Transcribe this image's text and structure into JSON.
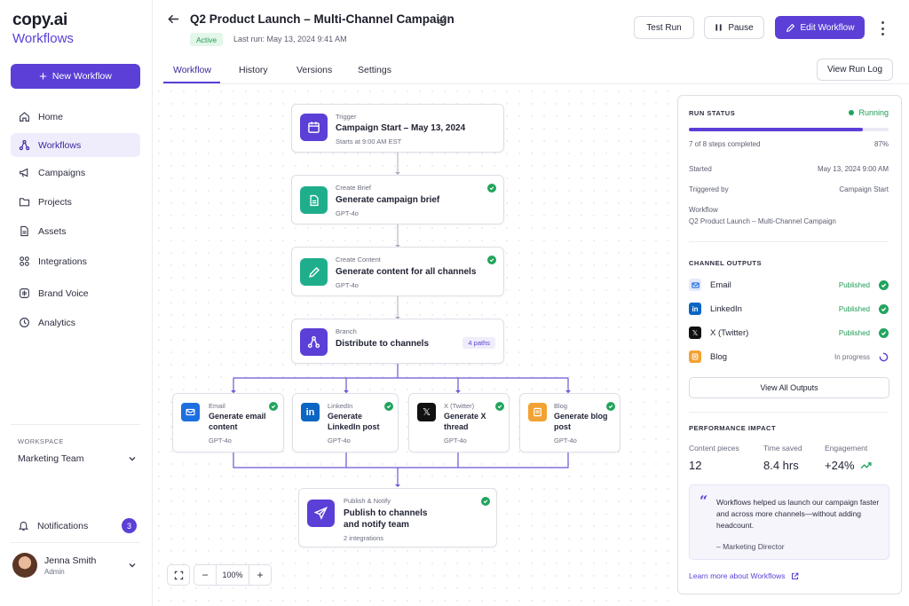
{
  "brand": {
    "logo": "copy.ai",
    "product": "Workflows"
  },
  "sidebar": {
    "new_workflow": "New Workflow",
    "items": [
      {
        "label": "Home",
        "icon": "home-icon"
      },
      {
        "label": "Workflows",
        "icon": "workflow-icon",
        "active": true
      },
      {
        "label": "Campaigns",
        "icon": "megaphone-icon"
      },
      {
        "label": "Projects",
        "icon": "folder-icon"
      },
      {
        "label": "Assets",
        "icon": "file-icon"
      },
      {
        "label": "Integrations",
        "icon": "grid-icon"
      },
      {
        "label": "Brand Voice",
        "icon": "voice-icon"
      },
      {
        "label": "Analytics",
        "icon": "analytics-icon"
      }
    ],
    "workspace_label": "WORKSPACE",
    "workspace": "Marketing Team",
    "notifications": "Notifications",
    "notifications_count": "3",
    "user": {
      "name": "Jenna Smith",
      "role": "Admin"
    }
  },
  "header": {
    "title": "Q2 Product Launch – Multi-Channel Campaign",
    "status": "Active",
    "last_run": "Last run: May 13, 2024 9:41 AM",
    "test_run": "Test Run",
    "pause": "Pause",
    "edit": "Edit Workflow"
  },
  "tabs": [
    "Workflow",
    "History",
    "Versions",
    "Settings"
  ],
  "view_run_log": "View Run Log",
  "canvas": {
    "trigger": {
      "label": "Trigger",
      "title": "Campaign Start – May 13, 2024",
      "sub": "Starts at 9:00 AM EST"
    },
    "brief": {
      "label": "Create Brief",
      "title": "Generate campaign brief",
      "sub": "GPT-4o"
    },
    "content": {
      "label": "Create Content",
      "title": "Generate content for all channels",
      "sub": "GPT-4o"
    },
    "branch": {
      "label": "Branch",
      "title": "Distribute to channels",
      "badge": "4 paths"
    },
    "channels": [
      {
        "label": "Email",
        "title": "Generate email content",
        "sub": "GPT-4o"
      },
      {
        "label": "LinkedIn",
        "title": "Generate LinkedIn post",
        "sub": "GPT-4o"
      },
      {
        "label": "X (Twitter)",
        "title": "Generate X thread",
        "sub": "GPT-4o"
      },
      {
        "label": "Blog",
        "title": "Generate blog post",
        "sub": "GPT-4o"
      }
    ],
    "publish": {
      "label": "Publish & Notify",
      "title": "Publish to channels and notify team",
      "sub": "2 integrations"
    },
    "zoom": "100%"
  },
  "run_status": {
    "heading": "RUN STATUS",
    "state": "Running",
    "steps": "7 of 8 steps completed",
    "percent_label": "87%",
    "progress": 0.87,
    "started_label": "Started",
    "started": "May 13, 2024 9:00 AM",
    "triggered_label": "Triggered by",
    "triggered": "Campaign Start",
    "workflow_label": "Workflow",
    "workflow": "Q2 Product Launch – Multi-Channel Campaign"
  },
  "channel_outputs": {
    "heading": "CHANNEL OUTPUTS",
    "rows": [
      {
        "name": "Email",
        "status": "Published"
      },
      {
        "name": "LinkedIn",
        "status": "Published"
      },
      {
        "name": "X (Twitter)",
        "status": "Published"
      },
      {
        "name": "Blog",
        "status": "In progress"
      }
    ],
    "view_all": "View All Outputs"
  },
  "performance": {
    "heading": "PERFORMANCE IMPACT",
    "metrics": [
      {
        "label": "Content pieces",
        "value": "12"
      },
      {
        "label": "Time saved",
        "value": "8.4 hrs"
      },
      {
        "label": "Engagement",
        "value": "+24%"
      }
    ],
    "quote": "Workflows helped us launch our campaign faster and across more channels—without adding headcount.",
    "author": "– Marketing Director",
    "learn_more": "Learn more about Workflows"
  },
  "colors": {
    "accent": "#5b3fd6",
    "success": "#22a45d",
    "email": "#1d6fe0",
    "linkedin": "#0a66c2",
    "x": "#111111",
    "blog": "#f2a233",
    "brief": "#1fae8c"
  }
}
